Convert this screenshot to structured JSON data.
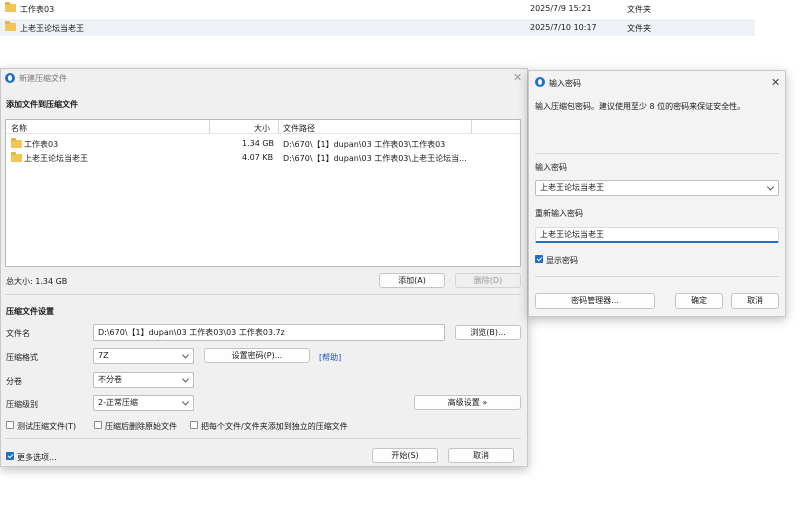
{
  "background_list": {
    "rows": [
      {
        "name": "工作表03",
        "date": "2025/7/9 15:21",
        "type": "文件夹"
      },
      {
        "name": "上老王论坛当老王",
        "date": "2025/7/10 10:17",
        "type": "文件夹"
      }
    ]
  },
  "compress_dialog": {
    "title": "新建压缩文件",
    "add_section_title": "添加文件到压缩文件",
    "columns": {
      "name": "名称",
      "size": "大小",
      "path": "文件路径"
    },
    "files": [
      {
        "name": "工作表03",
        "size": "1.34 GB",
        "path": "D:\\670\\【1】dupan\\03 工作表03\\工作表03"
      },
      {
        "name": "上老王论坛当老王",
        "size": "4.07 KB",
        "path": "D:\\670\\【1】dupan\\03 工作表03\\上老王论坛当..."
      }
    ],
    "total_size": "总大小: 1.34 GB",
    "add_button": "添加(A)",
    "delete_button": "删除(D)",
    "settings_title": "压缩文件设置",
    "filename_label": "文件名",
    "filename_value": "D:\\670\\【1】dupan\\03 工作表03\\03 工作表03.7z",
    "browse_button": "浏览(B)...",
    "format_label": "压缩格式",
    "format_value": "7Z",
    "set_password_button": "设置密码(P)...",
    "help_link": "[帮助]",
    "split_label": "分卷",
    "split_value": "不分卷",
    "level_label": "压缩级别",
    "level_value": "2-正常压缩",
    "advanced_button": "高级设置 »",
    "test_label": "测试压缩文件(T)",
    "delete_source_label": "压缩后删除原始文件",
    "separate_label": "把每个文件/文件夹添加到独立的压缩文件",
    "more_options_label": "更多选项...",
    "start_button": "开始(S)",
    "cancel_button": "取消"
  },
  "password_dialog": {
    "title": "输入密码",
    "description": "输入压缩包密码。建议使用至少 8 位的密码来保证安全性。",
    "enter_label": "输入密码",
    "enter_value": "上老王论坛当老王",
    "reenter_label": "重新输入密码",
    "reenter_value": "上老王论坛当老王",
    "show_password_label": "显示密码",
    "manager_button": "密码管理器...",
    "ok_button": "确定",
    "cancel_button": "取消"
  },
  "colors": {
    "accent": "#1f6fc5",
    "folder": "#f2c557"
  }
}
